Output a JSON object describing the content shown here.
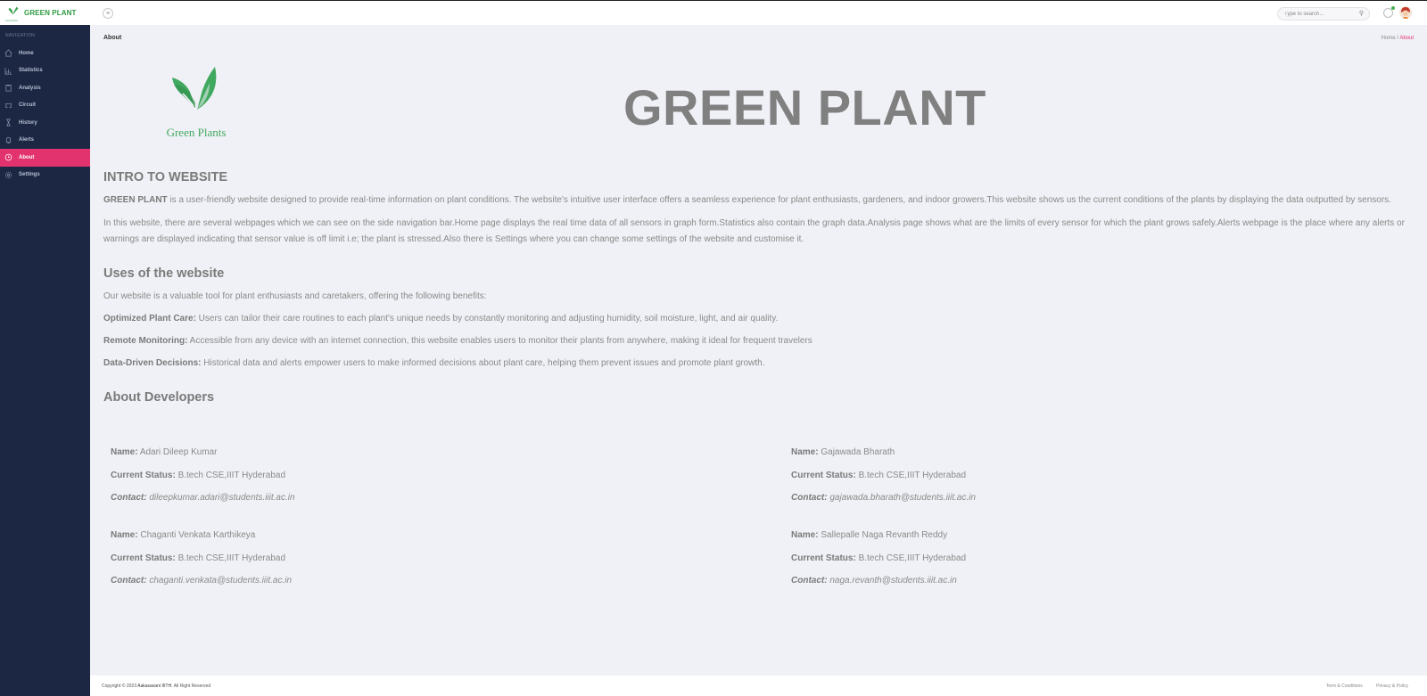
{
  "app": {
    "brand_name": "GREEN PLANT",
    "brand_tagline": "Green Plants",
    "accent_color": "#e2336f",
    "brand_color": "#2e9b3f"
  },
  "topbar": {
    "search_placeholder": "Type to search...",
    "search_icon": "search-icon",
    "menu_icon": "hamburger-icon",
    "notification_icon": "bell-icon",
    "avatar_icon": "user-avatar"
  },
  "sidebar": {
    "caption": "NAVIGATION",
    "items": [
      {
        "label": "Home",
        "icon": "home-icon"
      },
      {
        "label": "Statistics",
        "icon": "chart-icon"
      },
      {
        "label": "Analysis",
        "icon": "clipboard-icon"
      },
      {
        "label": "Circuit",
        "icon": "circuit-icon"
      },
      {
        "label": "History",
        "icon": "hourglass-icon"
      },
      {
        "label": "Alerts",
        "icon": "bell-icon"
      },
      {
        "label": "About",
        "icon": "clock-icon",
        "active": true
      },
      {
        "label": "Settings",
        "icon": "gear-icon"
      }
    ]
  },
  "page": {
    "title": "About",
    "breadcrumb_home": "Home",
    "breadcrumb_sep": " / ",
    "breadcrumb_current": "About",
    "hero_title": "GREEN PLANT"
  },
  "intro": {
    "heading": "INTRO TO WEBSITE",
    "lead_bold": "GREEN PLANT",
    "p1": " is a user-friendly website designed to provide real-time information on plant conditions. The website's intuitive user interface offers a seamless experience for plant enthusiasts, gardeners, and indoor growers.This website shows us the current conditions of the plants by displaying the data outputted by sensors.",
    "p2": "In this website, there are several webpages which we can see on the side navigation bar.Home page displays the real time data of all sensors in graph form.Statistics also contain the graph data.Analysis page shows what are the limits of every sensor for which the plant grows safely.Alerts webpage is the place where any alerts or warnings are displayed indicating that sensor value is off limit i.e; the plant is stressed.Also there is Settings where you can change some settings of the website and customise it."
  },
  "uses": {
    "heading": "Uses of the website",
    "intro": "Our website is a valuable tool for plant enthusiasts and caretakers, offering the following benefits:",
    "items": [
      {
        "label": "Optimized Plant Care:",
        "text": " Users can tailor their care routines to each plant's unique needs by constantly monitoring and adjusting humidity, soil moisture, light, and air quality."
      },
      {
        "label": "Remote Monitoring:",
        "text": " Accessible from any device with an internet connection, this website enables users to monitor their plants from anywhere, making it ideal for frequent travelers"
      },
      {
        "label": "Data-Driven Decisions:",
        "text": " Historical data and alerts empower users to make informed decisions about plant care, helping them prevent issues and promote plant growth."
      }
    ]
  },
  "developers": {
    "heading": "About Developers",
    "name_label": "Name:",
    "status_label": "Current Status:",
    "contact_label": "Contact:",
    "list": [
      {
        "name": "Adari Dileep Kumar",
        "status": "B.tech CSE,IIIT Hyderabad",
        "contact": "dileepkumar.adari@students.iiit.ac.in"
      },
      {
        "name": "Gajawada Bharath",
        "status": "B.tech CSE,IIIT Hyderabad",
        "contact": "gajawada.bharath@students.iiit.ac.in"
      },
      {
        "name": "Chaganti Venkata Karthikeya",
        "status": "B.tech CSE,IIIT Hyderabad",
        "contact": "chaganti.venkata@students.iiit.ac.in"
      },
      {
        "name": "Sallepalle Naga Revanth Reddy",
        "status": "B.tech CSE,IIIT Hyderabad",
        "contact": "naga.revanth@students.iiit.ac.in"
      }
    ]
  },
  "footer": {
    "copyright_prefix": "Copyright © 2023 ",
    "copyright_org": "Aakasavani IIITH.",
    "copyright_suffix": " All Right Reserved",
    "terms": "Term & Conditions",
    "privacy": "Privacy & Policy"
  }
}
